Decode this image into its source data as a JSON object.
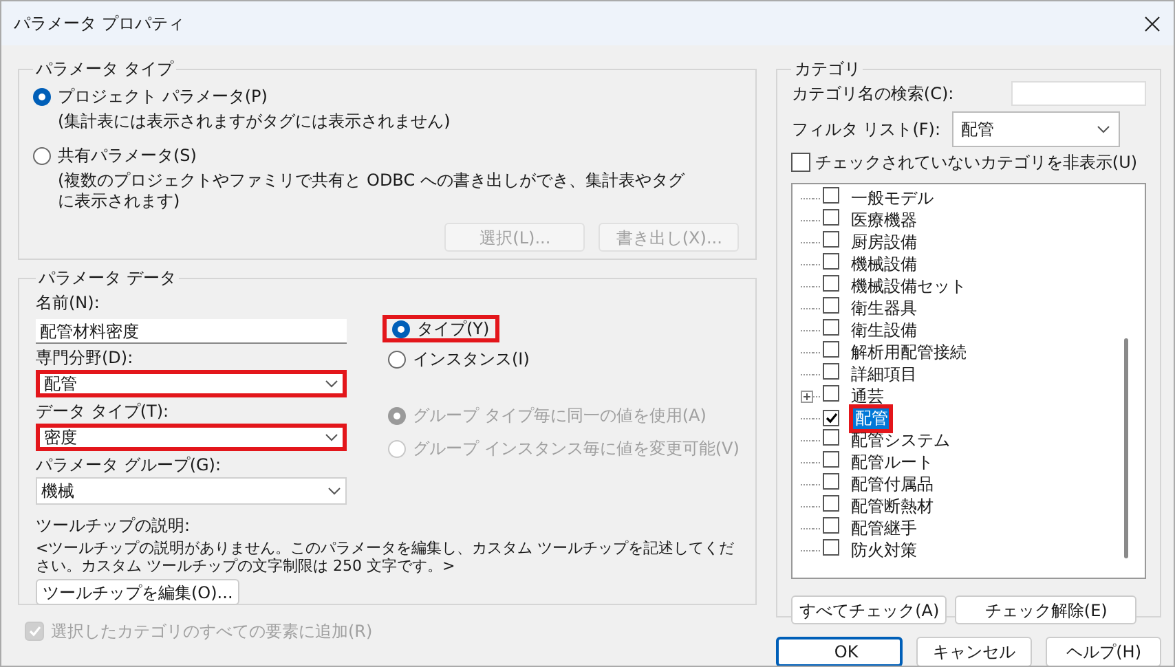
{
  "window": {
    "title": "パラメータ プロパティ"
  },
  "parameter_type": {
    "title": "パラメータ タイプ",
    "options": [
      {
        "label": "プロジェクト パラメータ(P)",
        "note": "(集計表には表示されますがタグには表示されません)",
        "selected": true
      },
      {
        "label": "共有パラメータ(S)",
        "note": "(複数のプロジェクトやファミリで共有と ODBC への書き出しができ、集計表やタグに表示されます)",
        "selected": false
      }
    ],
    "buttons": [
      {
        "label": "選択(L)...",
        "disabled": true
      },
      {
        "label": "書き出し(X)...",
        "disabled": true
      }
    ]
  },
  "parameter_data": {
    "title": "パラメータ データ",
    "name": {
      "label": "名前(N):",
      "value": "配管材料密度"
    },
    "dropdowns": [
      {
        "label": "専門分野(D):",
        "value": "配管",
        "highlighted": true
      },
      {
        "label": "データ タイプ(T):",
        "value": "密度",
        "highlighted": true
      },
      {
        "label": "パラメータ グループ(G):",
        "value": "機械",
        "highlighted": false
      }
    ],
    "scope": [
      {
        "label": "タイプ(Y)",
        "selected": true,
        "highlighted": true
      },
      {
        "label": "インスタンス(I)",
        "selected": false,
        "highlighted": false
      }
    ],
    "group_options": [
      {
        "label": "グループ タイプ毎に同一の値を使用(A)",
        "selected": true,
        "disabled": true
      },
      {
        "label": "グループ インスタンス毎に値を変更可能(V)",
        "selected": false,
        "disabled": true
      }
    ],
    "tooltip": {
      "label": "ツールチップの説明:",
      "text": "<ツールチップの説明がありません。このパラメータを編集し、カスタム ツールチップを記述してください。カスタム ツールチップの文字制限は 250 文字です。>",
      "button": "ツールチップを編集(O)..."
    }
  },
  "add_to_all": {
    "label": "選択したカテゴリのすべての要素に追加(R)",
    "checked": true,
    "disabled": true
  },
  "categories": {
    "title": "カテゴリ",
    "search": {
      "label": "カテゴリ名の検索(C):"
    },
    "filter": {
      "label": "フィルタ リスト(F):",
      "value": "配管"
    },
    "hide_unchecked": {
      "label": "チェックされていないカテゴリを非表示(U)",
      "checked": false
    },
    "items": [
      {
        "label": "一般モデル",
        "checked": false,
        "selected": false,
        "expandable": false,
        "highlighted": false
      },
      {
        "label": "医療機器",
        "checked": false,
        "selected": false,
        "expandable": false,
        "highlighted": false
      },
      {
        "label": "厨房設備",
        "checked": false,
        "selected": false,
        "expandable": false,
        "highlighted": false
      },
      {
        "label": "機械設備",
        "checked": false,
        "selected": false,
        "expandable": false,
        "highlighted": false
      },
      {
        "label": "機械設備セット",
        "checked": false,
        "selected": false,
        "expandable": false,
        "highlighted": false
      },
      {
        "label": "衛生器具",
        "checked": false,
        "selected": false,
        "expandable": false,
        "highlighted": false
      },
      {
        "label": "衛生設備",
        "checked": false,
        "selected": false,
        "expandable": false,
        "highlighted": false
      },
      {
        "label": "解析用配管接続",
        "checked": false,
        "selected": false,
        "expandable": false,
        "highlighted": false
      },
      {
        "label": "詳細項目",
        "checked": false,
        "selected": false,
        "expandable": false,
        "highlighted": false
      },
      {
        "label": "通芸",
        "checked": false,
        "selected": false,
        "expandable": true,
        "highlighted": false
      },
      {
        "label": "配管",
        "checked": true,
        "selected": true,
        "expandable": false,
        "highlighted": true
      },
      {
        "label": "配管システム",
        "checked": false,
        "selected": false,
        "expandable": false,
        "highlighted": false
      },
      {
        "label": "配管ルート",
        "checked": false,
        "selected": false,
        "expandable": false,
        "highlighted": false
      },
      {
        "label": "配管付属品",
        "checked": false,
        "selected": false,
        "expandable": false,
        "highlighted": false
      },
      {
        "label": "配管断熱材",
        "checked": false,
        "selected": false,
        "expandable": false,
        "highlighted": false
      },
      {
        "label": "配管継手",
        "checked": false,
        "selected": false,
        "expandable": false,
        "highlighted": false
      },
      {
        "label": "防火対策",
        "checked": false,
        "selected": false,
        "expandable": false,
        "highlighted": false
      }
    ],
    "buttons": [
      "すべてチェック(A)",
      "チェック解除(E)"
    ]
  },
  "footer_buttons": [
    {
      "label": "OK",
      "default": true
    },
    {
      "label": "キャンセル",
      "default": false
    },
    {
      "label": "ヘルプ(H)",
      "default": false
    }
  ]
}
